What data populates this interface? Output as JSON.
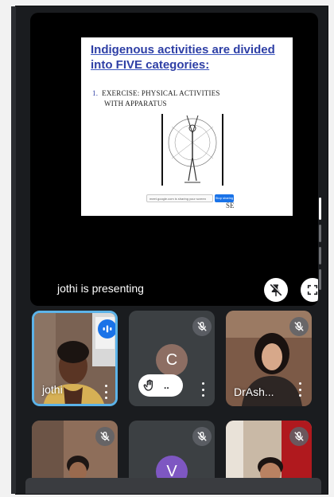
{
  "presentation": {
    "slide_title": "Indigenous activities are divided into FIVE categories:",
    "slide_item_number": "1.",
    "slide_item_line1": "EXERCISE: PHYSICAL ACTIVITIES",
    "slide_item_line2": "WITH APPARATUS",
    "screen_share_notice": "meet.google.com is sharing your screen",
    "stop_sharing_label": "Stop sharing",
    "slide_footer_tail": "SE",
    "presenting_text": "jothi is presenting"
  },
  "participants": [
    {
      "name": "jothi",
      "state": "speaking"
    },
    {
      "name": "",
      "avatar_letter": "C",
      "avatar_color": "#8d6e63",
      "state": "muted",
      "hand_raised": true,
      "hand_label": ".."
    },
    {
      "name": "DrAsh...",
      "state": "muted"
    },
    {
      "name": "",
      "state": "muted"
    },
    {
      "name": "",
      "avatar_letter": "V",
      "avatar_color": "#7e57c2",
      "state": "muted"
    },
    {
      "name": "",
      "state": "muted"
    }
  ],
  "colors": {
    "background": "#1a1c1f",
    "tile": "#3c4043",
    "active_border": "#5cb3e8",
    "accent": "#1a73e8"
  }
}
